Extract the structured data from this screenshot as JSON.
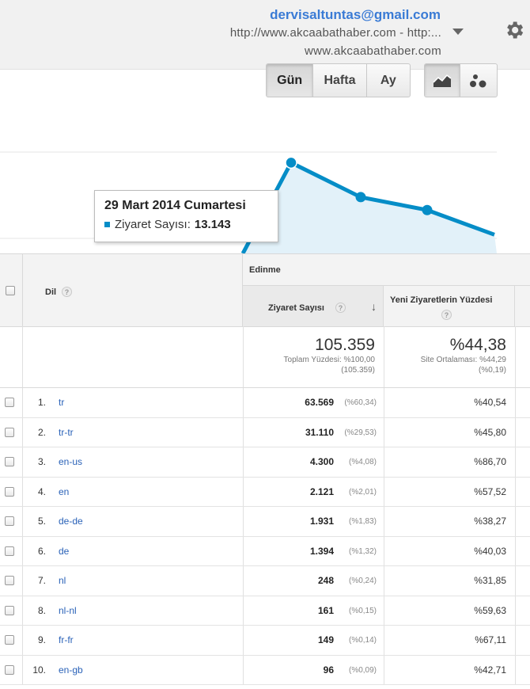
{
  "header": {
    "email": "dervisaltuntas@gmail.com",
    "account_url": "http://www.akcaabathaber.com - http:...",
    "property_url": "www.akcaabathaber.com"
  },
  "toolbar": {
    "period_buttons": [
      "Gün",
      "Hafta",
      "Ay"
    ],
    "active_period": "Gün"
  },
  "chart_data": {
    "type": "line",
    "series": [
      {
        "values": [
          null,
          13143,
          10200,
          9100,
          7000
        ]
      }
    ],
    "color": "#058dc7",
    "fill": "#e2f1f9",
    "tooltip": {
      "date": "29 Mart 2014 Cumartesi",
      "metric_label": "Ziyaret Sayısı:",
      "metric_value": "13.143"
    }
  },
  "table": {
    "group_header": "Edinme",
    "columns": {
      "dimension": "Dil",
      "sessions": "Ziyaret Sayısı",
      "new_visits": "Yeni Ziyaretlerin Yüzdesi"
    },
    "totals": {
      "sessions": "105.359",
      "sessions_note_1": "Toplam Yüzdesi: %100,00",
      "sessions_note_2": "(105.359)",
      "new_visits": "%44,38",
      "new_visits_note_1": "Site Ortalaması: %44,29",
      "new_visits_note_2": "(%0,19)"
    },
    "rows": [
      {
        "num": "1.",
        "dim": "tr",
        "sessions": "63.569",
        "pct": "(%60,34)",
        "new": "%40,54"
      },
      {
        "num": "2.",
        "dim": "tr-tr",
        "sessions": "31.110",
        "pct": "(%29,53)",
        "new": "%45,80"
      },
      {
        "num": "3.",
        "dim": "en-us",
        "sessions": "4.300",
        "pct": "(%4,08)",
        "new": "%86,70"
      },
      {
        "num": "4.",
        "dim": "en",
        "sessions": "2.121",
        "pct": "(%2,01)",
        "new": "%57,52"
      },
      {
        "num": "5.",
        "dim": "de-de",
        "sessions": "1.931",
        "pct": "(%1,83)",
        "new": "%38,27"
      },
      {
        "num": "6.",
        "dim": "de",
        "sessions": "1.394",
        "pct": "(%1,32)",
        "new": "%40,03"
      },
      {
        "num": "7.",
        "dim": "nl",
        "sessions": "248",
        "pct": "(%0,24)",
        "new": "%31,85"
      },
      {
        "num": "8.",
        "dim": "nl-nl",
        "sessions": "161",
        "pct": "(%0,15)",
        "new": "%59,63"
      },
      {
        "num": "9.",
        "dim": "fr-fr",
        "sessions": "149",
        "pct": "(%0,14)",
        "new": "%67,11"
      },
      {
        "num": "10.",
        "dim": "en-gb",
        "sessions": "96",
        "pct": "(%0,09)",
        "new": "%42,71"
      }
    ]
  }
}
